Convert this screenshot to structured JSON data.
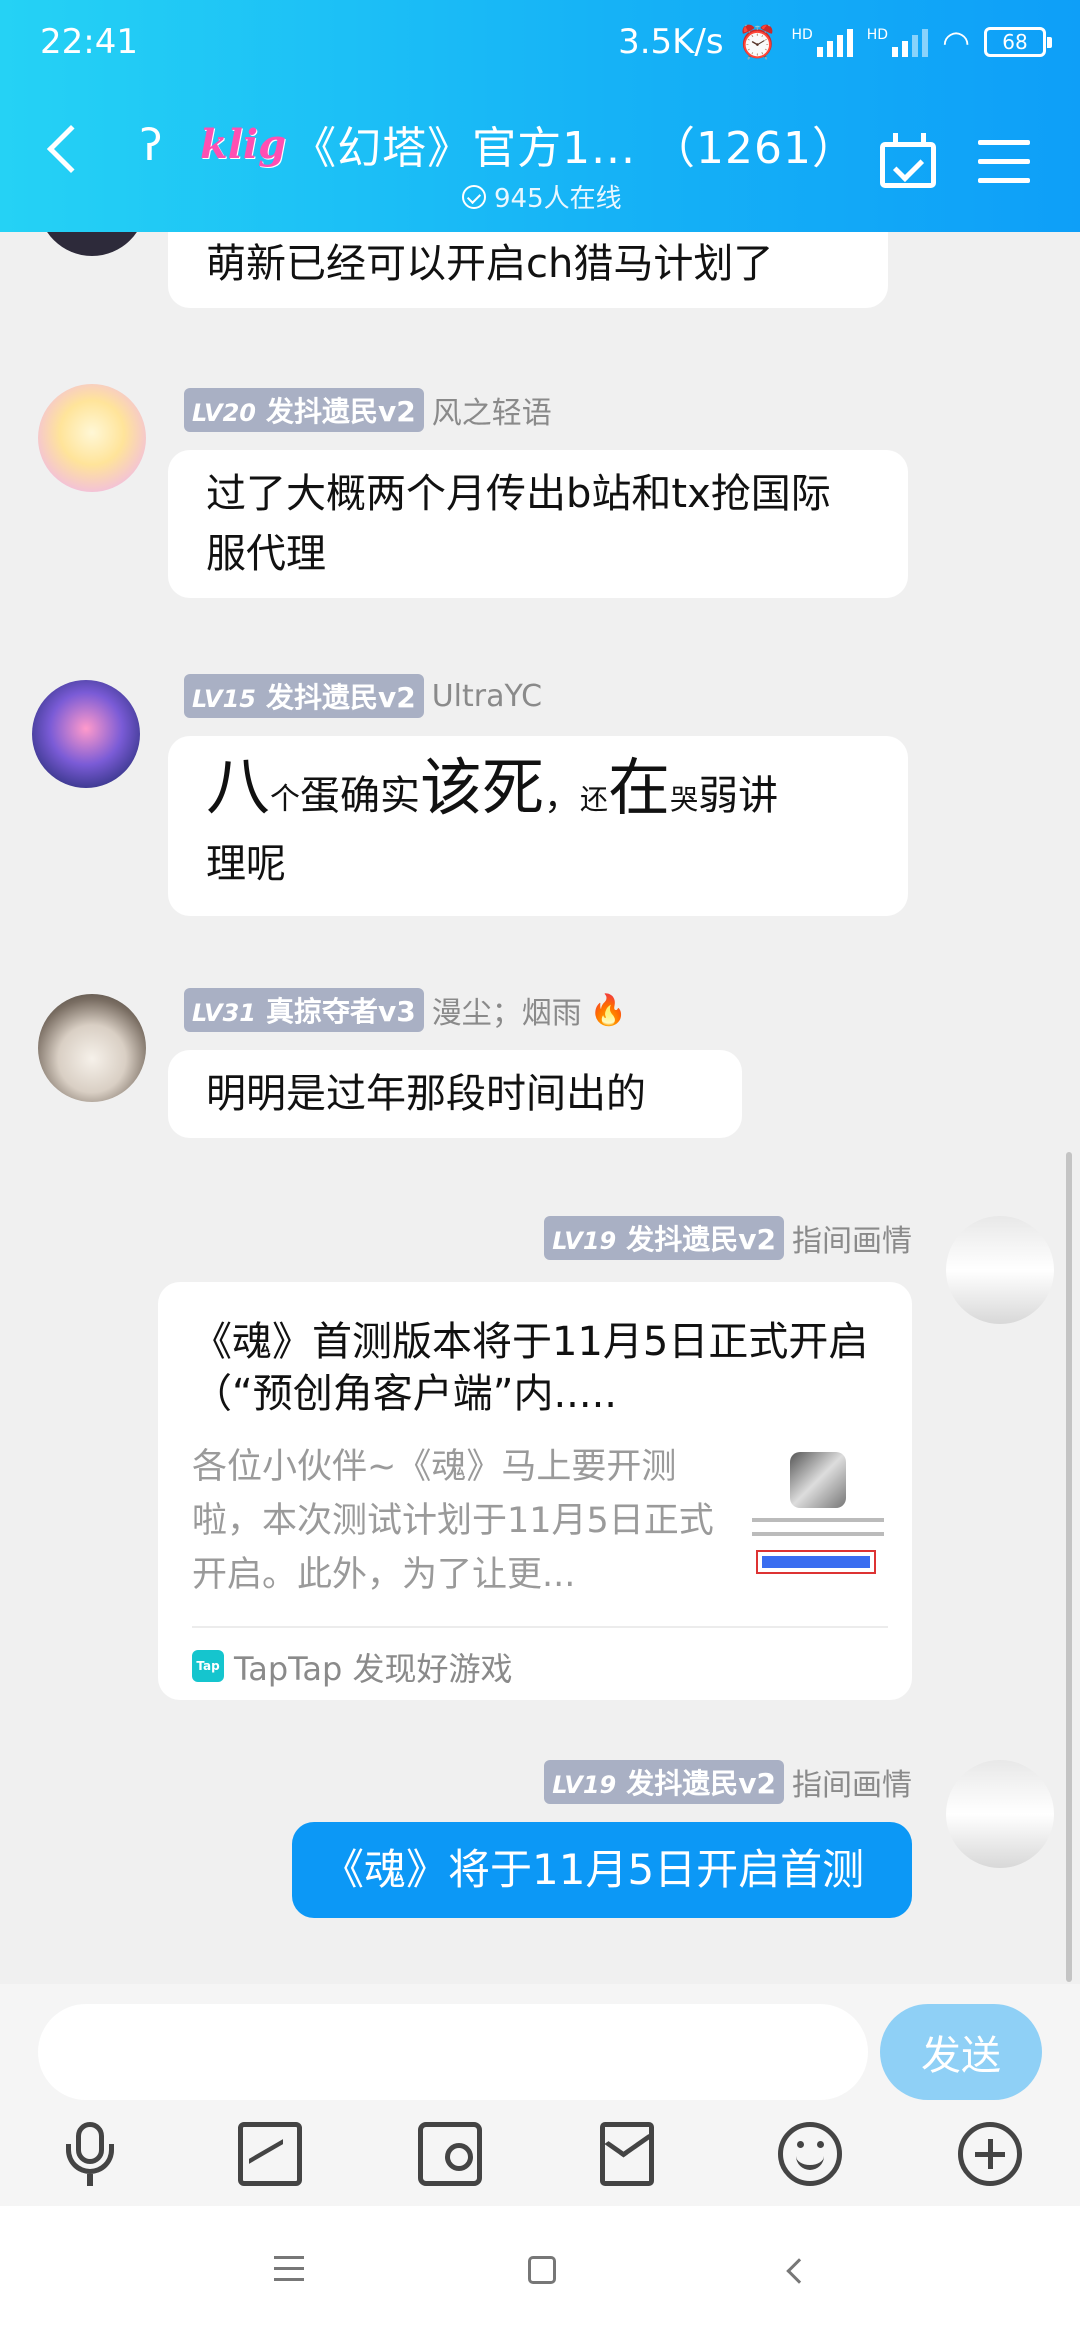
{
  "status_bar": {
    "time": "22:41",
    "net_speed": "3.5K/s",
    "network_label_1": "HD",
    "network_label_2": "HD",
    "battery": "68"
  },
  "header": {
    "logo_text": "klig",
    "title": "《幻塔》官方1... （1261）",
    "online": "945人在线"
  },
  "messages": [
    {
      "text": "萌新已经可以开启ch猎马计划了"
    },
    {
      "level": "LV20",
      "title": "发抖遗民v2",
      "name": "风之轻语",
      "text": "过了大概两个月传出b站和tx抢国际服代理"
    },
    {
      "level": "LV15",
      "title": "发抖遗民v2",
      "name": "UltraYC",
      "parts": [
        "八",
        "个",
        "蛋确实",
        "该死",
        "，",
        "还",
        "在",
        "哭",
        "弱讲",
        "理呢"
      ]
    },
    {
      "level": "LV31",
      "title": "真掠夺者v3",
      "name": "漫尘；烟雨",
      "flame": "🔥",
      "text": "明明是过年那段时间出的"
    },
    {
      "level": "LV19",
      "title": "发抖遗民v2",
      "name": "指间画情",
      "card": {
        "title": "《魂》首测版本将于11月5日正式开启（“预创角客户端”内.....",
        "desc": "各位小伙伴~《魂》马上要开测啦，本次测试计划于11月5日正式开启。此外，为了让更...",
        "source_icon": "Tap",
        "source": "TapTap 发现好游戏"
      }
    },
    {
      "level": "LV19",
      "title": "发抖遗民v2",
      "name": "指间画情",
      "text": "《魂》将于11月5日开启首测"
    }
  ],
  "input": {
    "placeholder": "",
    "send_label": "发送"
  },
  "colors": {
    "accent": "#0c98f6",
    "header_start": "#25d2f5",
    "send_disabled": "#8fd0f6",
    "badge": "#a9b0c4"
  },
  "icons": [
    "back-icon",
    "ear-icon",
    "calendar-check-icon",
    "menu-icon",
    "mic-icon",
    "image-icon",
    "camera-icon",
    "red-packet-icon",
    "emoji-icon",
    "plus-icon"
  ]
}
